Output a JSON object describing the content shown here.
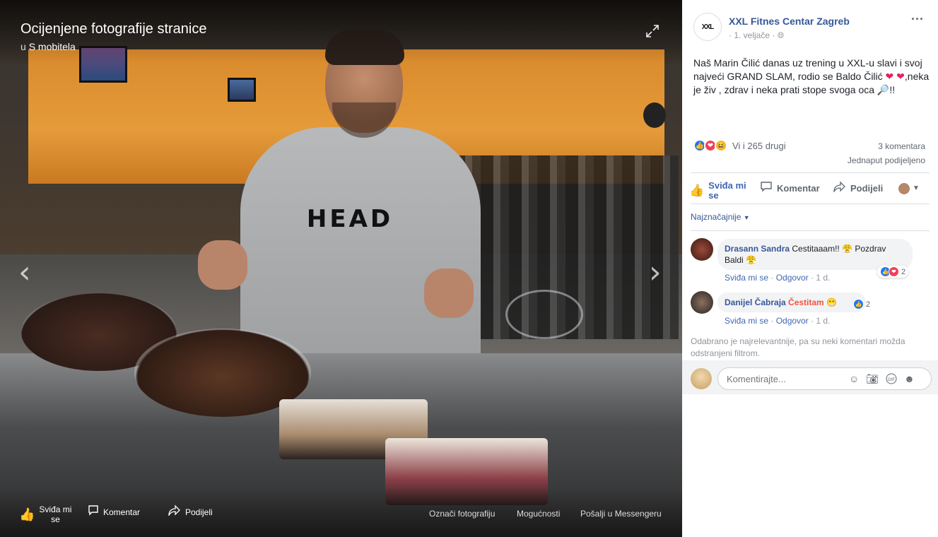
{
  "photo": {
    "album_title": "Ocijenjene fotografije stranice",
    "album_sub_prefix": "u",
    "album_sub_link": "S mobitela",
    "shirt_logo": "HEAD",
    "bottom_actions": {
      "like_line1": "Sviđa mi",
      "like_line2": "se",
      "comment": "Komentar",
      "share": "Podijeli"
    },
    "right_actions": [
      "Označi fotografiju",
      "Mogućnosti",
      "Pošalji u Messengeru"
    ],
    "icons": {
      "expand": "expand-icon",
      "prev": "chevron-left-icon",
      "next": "chevron-right-icon"
    }
  },
  "post": {
    "page_avatar_text": "XXL",
    "page_name": "XXL Fitnes Centar Zagreb",
    "date": "· 1. veljače ·",
    "privacy_icon": "globe-icon",
    "text_part1": "Naš Marin Čilić danas uz trening u XXL-u slavi i svoj najveći GRAND SLAM, rodio se Baldo Čilić ",
    "text_part2": ",neka je živ , zdrav i neka prati stope svoga oca ",
    "text_part3": "!!",
    "reactions_text": "Vi i 265 drugi",
    "comments_count": "3 komentara",
    "shares_count": "Jednaput podijeljeno"
  },
  "actions": {
    "like_line1": "Sviđa mi",
    "like_line2": "se",
    "comment": "Komentar",
    "share": "Podijeli"
  },
  "sort_label": "Najznačajnije",
  "comments": [
    {
      "author": "Drasann Sandra",
      "text": "Cestitaaam!! 😤 Pozdrav Baldi 😤",
      "react_count": "2",
      "meta_like": "Sviđa mi se",
      "meta_reply": "Odgovor",
      "meta_time": "· 1 d."
    },
    {
      "author": "Danijel Čabraja",
      "text": "Čestitam",
      "emoji": "😁",
      "react_count": "2",
      "meta_like": "Sviđa mi se",
      "meta_reply": "Odgovor",
      "meta_time": "· 1 d."
    }
  ],
  "filter_note": "Odabrano je najrelevantnije, pa su neki komentari možda odstranjeni filtrom.",
  "composer": {
    "placeholder": "Komentirajte..."
  },
  "colors": {
    "link": "#365899",
    "like_blue": "#4267b2",
    "panel_bg": "#ffffff"
  }
}
